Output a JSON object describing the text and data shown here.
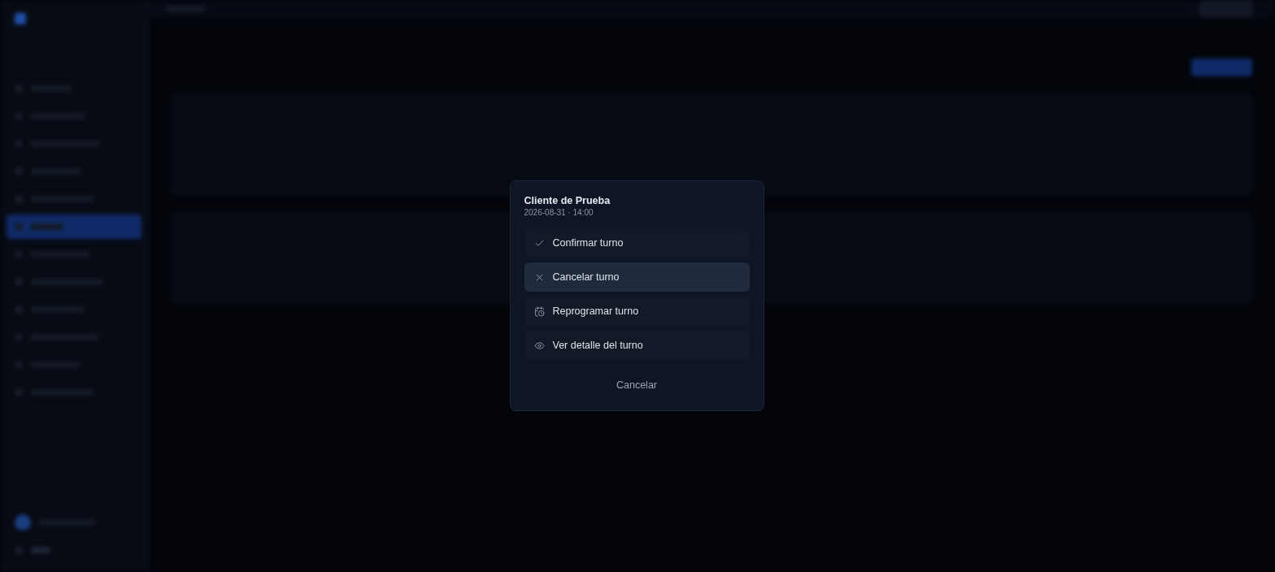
{
  "dialog": {
    "title": "Cliente de Prueba",
    "subtitle": "2026-08-31 · 14:00",
    "actions": [
      {
        "kind": "confirm",
        "label": "Confirmar turno",
        "hovered": false
      },
      {
        "kind": "cancel",
        "label": "Cancelar turno",
        "hovered": true
      },
      {
        "kind": "reschedule",
        "label": "Reprogramar turno",
        "hovered": false
      },
      {
        "kind": "view",
        "label": "Ver detalle del turno",
        "hovered": false
      }
    ],
    "dismiss": "Cancelar"
  }
}
